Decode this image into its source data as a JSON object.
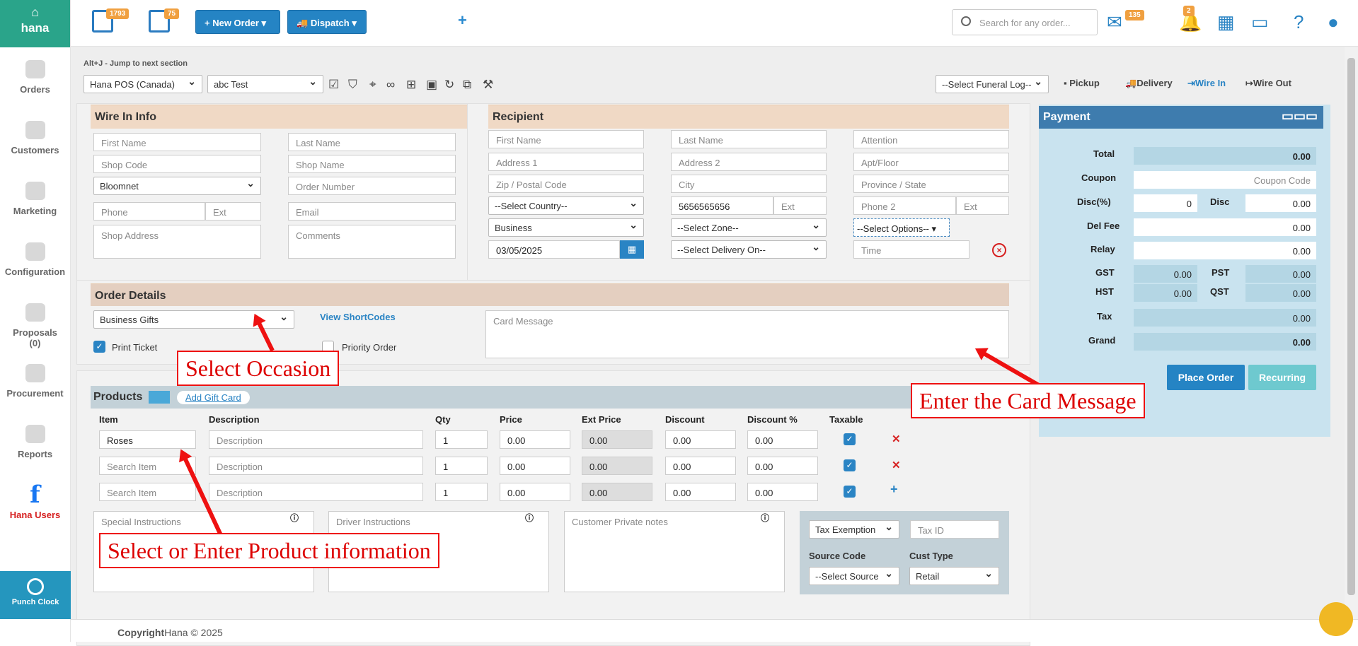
{
  "sidebar": {
    "logo": "hana",
    "items": [
      "Orders",
      "Customers",
      "Marketing",
      "Configuration",
      "Proposals",
      "(0)",
      "Procurement",
      "Reports",
      "Hana Users"
    ],
    "punch": "Punch Clock"
  },
  "topbar": {
    "badge1": "1793",
    "badge2": "75",
    "new_order": "+ New Order ▾",
    "dispatch": "Dispatch ▾",
    "search_placeholder": "Search for any order...",
    "mail_badge": "135",
    "bell_badge": "2"
  },
  "hint": "Alt+J - Jump to next section",
  "toolbar": {
    "store": "Hana POS (Canada)",
    "user": "abc Test",
    "funeral": "--Select Funeral Log--",
    "pickup": "Pickup",
    "delivery": "Delivery",
    "wire_in": "Wire In",
    "wire_out": "Wire Out"
  },
  "wire_in": {
    "title": "Wire In Info",
    "first": "First Name",
    "last": "Last Name",
    "shop_code": "Shop Code",
    "shop_name": "Shop Name",
    "network": "Bloomnet",
    "order_no": "Order Number",
    "phone": "Phone",
    "ext": "Ext",
    "email": "Email",
    "address": "Shop Address",
    "comments": "Comments"
  },
  "recipient": {
    "title": "Recipient",
    "first": "First Name",
    "last": "Last Name",
    "attention": "Attention",
    "addr1": "Address 1",
    "addr2": "Address 2",
    "apt": "Apt/Floor",
    "zip": "Zip / Postal Code",
    "city": "City",
    "province": "Province / State",
    "country": "--Select Country--",
    "phone": "5656565656",
    "ext": "Ext",
    "phone2": "Phone 2",
    "ext2": "Ext",
    "type": "Business",
    "zone": "--Select Zone--",
    "options": "--Select Options-- ▾",
    "date": "03/05/2025",
    "delivery_on": "--Select Delivery On--",
    "time": "Time"
  },
  "payment": {
    "title": "Payment",
    "total": "Total",
    "total_v": "0.00",
    "coupon": "Coupon",
    "coupon_ph": "Coupon Code",
    "discp": "Disc(%)",
    "discp_v": "0",
    "disc": "Disc",
    "disc_v": "0.00",
    "del": "Del Fee",
    "del_v": "0.00",
    "relay": "Relay",
    "relay_v": "0.00",
    "gst": "GST",
    "gst_v": "0.00",
    "pst": "PST",
    "pst_v": "0.00",
    "hst": "HST",
    "hst_v": "0.00",
    "qst": "QST",
    "qst_v": "0.00",
    "tax": "Tax",
    "tax_v": "0.00",
    "grand": "Grand",
    "grand_v": "0.00",
    "place": "Place Order",
    "recurring": "Recurring"
  },
  "order": {
    "title": "Order Details",
    "occasion": "Business Gifts",
    "shortcodes": "View ShortCodes",
    "card": "Card Message",
    "print": "Print Ticket",
    "priority": "Priority Order"
  },
  "products": {
    "title": "Products",
    "gift": "Add Gift Card",
    "cols": [
      "Item",
      "Description",
      "Qty",
      "Price",
      "Ext Price",
      "Discount",
      "Discount %",
      "Taxable"
    ],
    "rows": [
      {
        "item": "Roses",
        "desc": "Description",
        "qty": "1",
        "price": "0.00",
        "ext": "0.00",
        "disc": "0.00",
        "discp": "0.00"
      },
      {
        "item": "Search Item",
        "desc": "Description",
        "qty": "1",
        "price": "0.00",
        "ext": "0.00",
        "disc": "0.00",
        "discp": "0.00"
      },
      {
        "item": "Search Item",
        "desc": "Description",
        "qty": "1",
        "price": "0.00",
        "ext": "0.00",
        "disc": "0.00",
        "discp": "0.00"
      }
    ],
    "special": "Special Instructions",
    "driver": "Driver Instructions",
    "private": "Customer Private notes",
    "tax_ex": "Tax Exemption",
    "tax_id": "Tax ID",
    "source_lbl": "Source Code",
    "source": "--Select Source",
    "cust_lbl": "Cust Type",
    "cust": "Retail"
  },
  "annotations": {
    "occasion": "Select Occasion",
    "card": "Enter the Card Message",
    "product": "Select or Enter Product information"
  },
  "footer": {
    "copy": "Copyright",
    "rest": "Hana © 2025"
  }
}
